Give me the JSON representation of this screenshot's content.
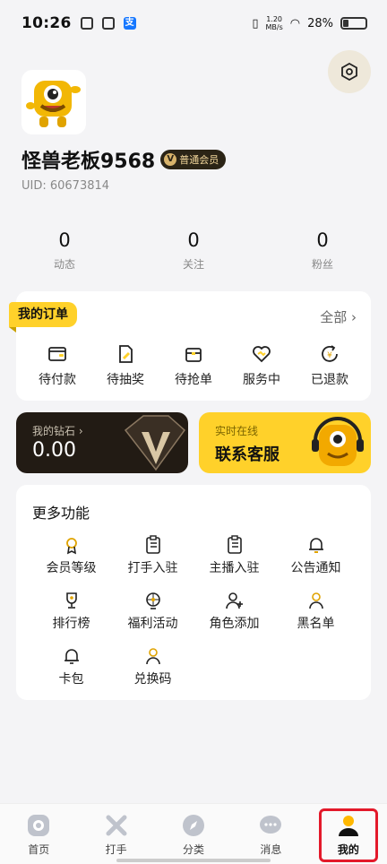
{
  "status_bar": {
    "time": "10:26",
    "speed_top": "1.20",
    "speed_bottom": "MB/s",
    "battery": "28%"
  },
  "profile": {
    "username": "怪兽老板9568",
    "member_badge": "普通会员",
    "uid": "UID: 60673814"
  },
  "stats": [
    {
      "value": "0",
      "label": "动态"
    },
    {
      "value": "0",
      "label": "关注"
    },
    {
      "value": "0",
      "label": "粉丝"
    }
  ],
  "orders": {
    "title": "我的订单",
    "all_label": "全部",
    "items": [
      {
        "label": "待付款",
        "icon": "wallet-icon"
      },
      {
        "label": "待抽奖",
        "icon": "document-pen-icon"
      },
      {
        "label": "待抢单",
        "icon": "box-icon"
      },
      {
        "label": "服务中",
        "icon": "heart-handshake-icon"
      },
      {
        "label": "已退款",
        "icon": "refund-icon"
      }
    ]
  },
  "diamond": {
    "title": "我的钻石",
    "value": "0.00"
  },
  "service": {
    "title": "实时在线",
    "label": "联系客服"
  },
  "more": {
    "title": "更多功能",
    "items": [
      {
        "label": "会员等级",
        "icon": "medal-icon"
      },
      {
        "label": "打手入驻",
        "icon": "clipboard-icon"
      },
      {
        "label": "主播入驻",
        "icon": "clipboard-icon"
      },
      {
        "label": "公告通知",
        "icon": "bell-icon"
      },
      {
        "label": "排行榜",
        "icon": "trophy-icon"
      },
      {
        "label": "福利活动",
        "icon": "wheel-icon"
      },
      {
        "label": "角色添加",
        "icon": "user-plus-icon"
      },
      {
        "label": "黑名单",
        "icon": "user-icon"
      },
      {
        "label": "卡包",
        "icon": "bell-icon"
      },
      {
        "label": "兑换码",
        "icon": "user-icon"
      }
    ]
  },
  "tabs": [
    {
      "label": "首页",
      "icon": "home-icon"
    },
    {
      "label": "打手",
      "icon": "swords-icon"
    },
    {
      "label": "分类",
      "icon": "compass-icon"
    },
    {
      "label": "消息",
      "icon": "chat-icon"
    },
    {
      "label": "我的",
      "icon": "profile-icon",
      "active": true
    }
  ],
  "colors": {
    "accent": "#ffd12a",
    "highlight": "#e3192a",
    "dark_card": "#221b14"
  }
}
